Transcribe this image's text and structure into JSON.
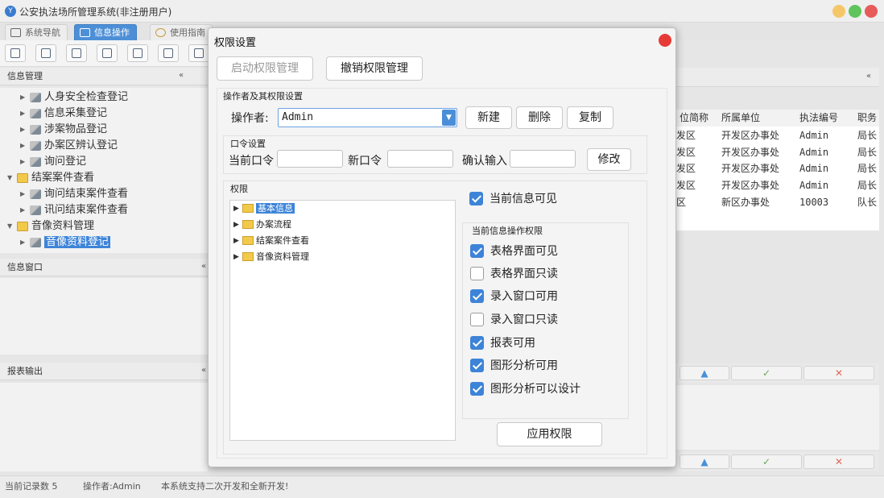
{
  "app": {
    "title": "公安执法场所管理系统(非注册用户)",
    "logo_text": "Y"
  },
  "tabs": [
    {
      "label": "系统导航",
      "active": false
    },
    {
      "label": "信息操作",
      "active": true
    },
    {
      "label": "使用指南",
      "active": false
    }
  ],
  "left_panel": {
    "title": "信息管理",
    "tree": [
      {
        "label": "人身安全检查登记",
        "type": "item"
      },
      {
        "label": "信息采集登记",
        "type": "item"
      },
      {
        "label": "涉案物品登记",
        "type": "item"
      },
      {
        "label": "办案区辨认登记",
        "type": "item"
      },
      {
        "label": "询问登记",
        "type": "item"
      },
      {
        "label": "结案案件查看",
        "type": "folder"
      },
      {
        "label": "询问结束案件查看",
        "type": "item"
      },
      {
        "label": "讯问结束案件查看",
        "type": "item"
      },
      {
        "label": "音像资料管理",
        "type": "folder"
      },
      {
        "label": "音像资料登记",
        "type": "item",
        "selected": true
      }
    ],
    "info_window_title": "信息窗口",
    "report_title": "报表输出"
  },
  "grid": {
    "columns": [
      "位简称",
      "所属单位",
      "执法编号",
      "职务"
    ],
    "rows": [
      [
        "发区",
        "开发区办事处",
        "Admin",
        "局长"
      ],
      [
        "发区",
        "开发区办事处",
        "Admin",
        "局长"
      ],
      [
        "发区",
        "开发区办事处",
        "Admin",
        "局长"
      ],
      [
        "发区",
        "开发区办事处",
        "Admin",
        "局长"
      ],
      [
        "区",
        "新区办事处",
        "10003",
        "队长"
      ]
    ]
  },
  "nav_icons": {
    "up": "▲",
    "confirm": "✓",
    "cancel": "✕"
  },
  "status": {
    "record_count": "当前记录数 5",
    "operator": "操作者:Admin",
    "notice": "本系统支持二次开发和全新开发!"
  },
  "dialog": {
    "title": "权限设置",
    "enable_button": "启动权限管理",
    "revoke_button": "撤销权限管理",
    "operator_group_title": "操作者及其权限设置",
    "operator_label": "操作者:",
    "operator_value": "Admin",
    "new_button": "新建",
    "delete_button": "删除",
    "copy_button": "复制",
    "password_group_title": "口令设置",
    "current_password_label": "当前口令",
    "new_password_label": "新口令",
    "confirm_label": "确认输入",
    "modify_button": "修改",
    "perm_group_title": "权限",
    "perm_tree": [
      {
        "label": "基本信息",
        "selected": true
      },
      {
        "label": "办案流程",
        "selected": false
      },
      {
        "label": "结案案件查看",
        "selected": false
      },
      {
        "label": "音像资料管理",
        "selected": false
      }
    ],
    "current_visible": {
      "label": "当前信息可见",
      "checked": true
    },
    "ops_group_title": "当前信息操作权限",
    "ops": [
      {
        "label": "表格界面可见",
        "checked": true
      },
      {
        "label": "表格界面只读",
        "checked": false
      },
      {
        "label": "录入窗口可用",
        "checked": true
      },
      {
        "label": "录入窗口只读",
        "checked": false
      },
      {
        "label": "报表可用",
        "checked": true
      },
      {
        "label": "图形分析可用",
        "checked": true
      },
      {
        "label": "图形分析可以设计",
        "checked": true
      }
    ],
    "apply_button": "应用权限"
  }
}
